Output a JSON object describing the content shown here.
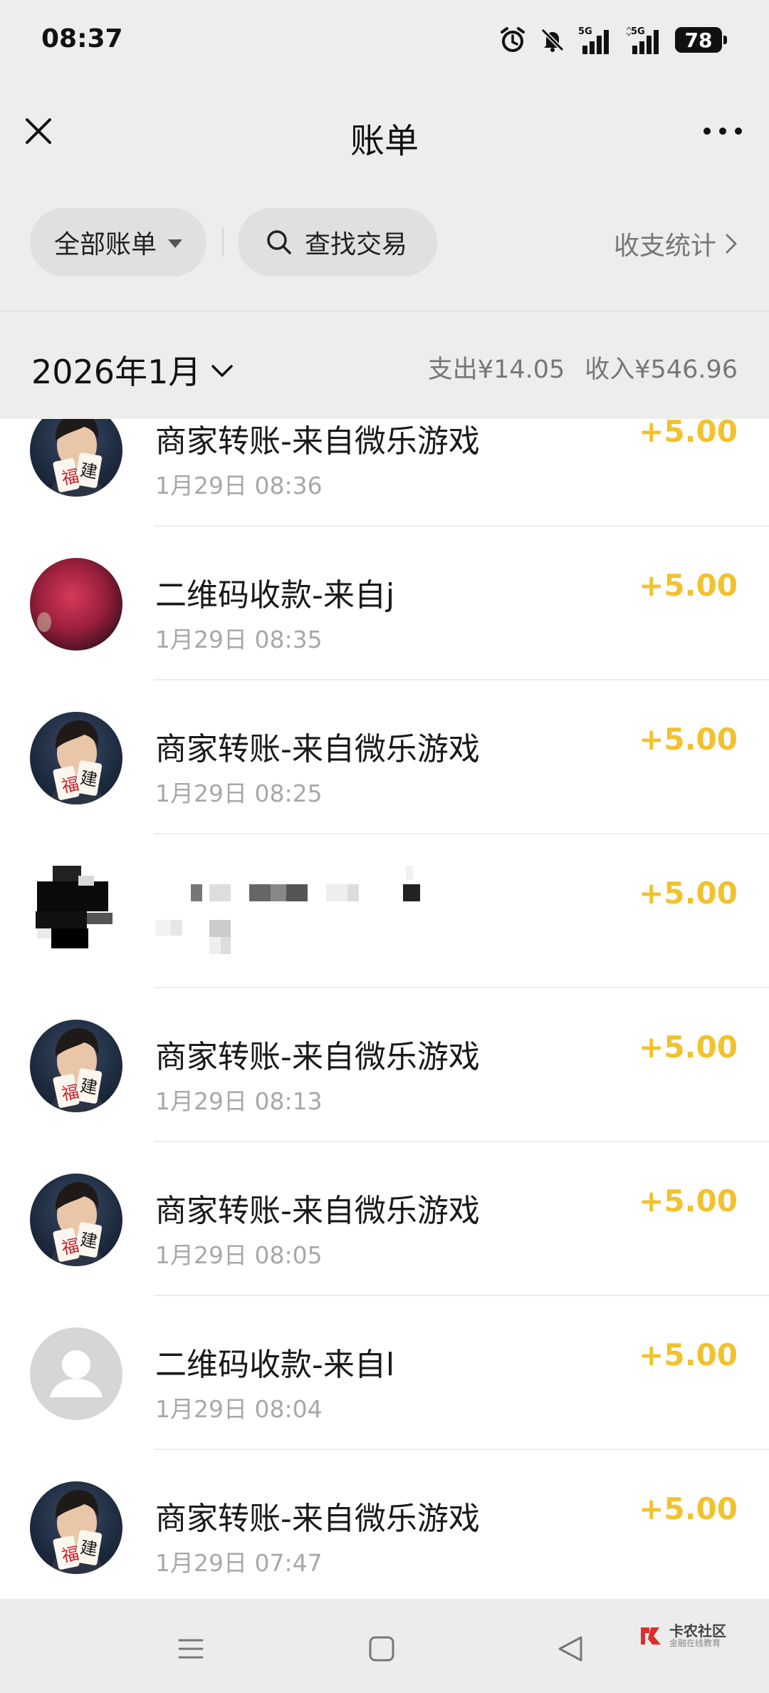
{
  "status_bar": {
    "time": "08:37",
    "signal_1_label": "5G",
    "signal_2_label": "5G",
    "battery": "78",
    "icons": [
      "alarm-icon",
      "mute-icon",
      "signal-icon",
      "signal-icon",
      "battery-icon"
    ]
  },
  "header": {
    "title": "账单",
    "close_icon": "close-icon",
    "more_icon": "more-icon"
  },
  "filter": {
    "all_label": "全部账单",
    "search_label": "查找交易",
    "stats_label": "收支统计"
  },
  "month": {
    "label": "2026年1月",
    "expense": "支出¥14.05",
    "income": "收入¥546.96"
  },
  "transactions": [
    {
      "title": "商家转账-来自微乐游戏",
      "time": "1月29日 08:36",
      "amount": "+5.00",
      "avatar": "game"
    },
    {
      "title": "二维码收款-来自j",
      "time": "1月29日 08:35",
      "amount": "+5.00",
      "avatar": "qr"
    },
    {
      "title": "商家转账-来自微乐游戏",
      "time": "1月29日 08:25",
      "amount": "+5.00",
      "avatar": "game"
    },
    {
      "title": "",
      "time": "",
      "amount": "+5.00",
      "avatar": "blurred"
    },
    {
      "title": "商家转账-来自微乐游戏",
      "time": "1月29日 08:13",
      "amount": "+5.00",
      "avatar": "game"
    },
    {
      "title": "商家转账-来自微乐游戏",
      "time": "1月29日 08:05",
      "amount": "+5.00",
      "avatar": "game"
    },
    {
      "title": "二维码收款-来自l",
      "time": "1月29日 08:04",
      "amount": "+5.00",
      "avatar": "default"
    },
    {
      "title": "商家转账-来自微乐游戏",
      "time": "1月29日 07:47",
      "amount": "+5.00",
      "avatar": "game"
    }
  ],
  "avatar_text": {
    "fu": "福",
    "jian": "建"
  },
  "nav": {
    "watermark_main": "卡农社区",
    "watermark_sub": "金融在线教育"
  },
  "colors": {
    "amount": "#f2c12e",
    "background": "#ededed"
  }
}
